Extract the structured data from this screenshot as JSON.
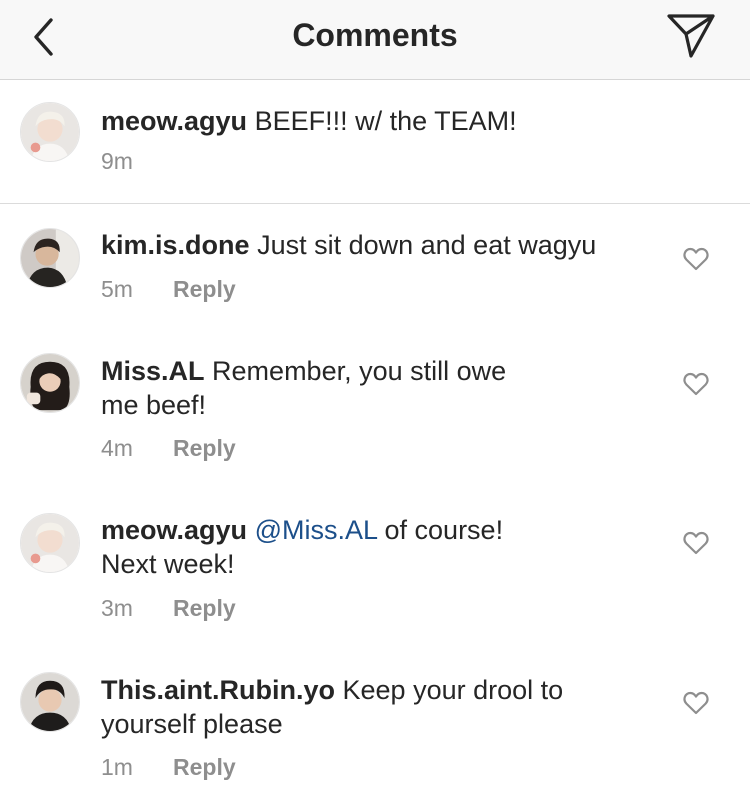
{
  "header": {
    "title": "Comments",
    "back_icon": "chevron-left-icon",
    "send_icon": "paper-plane-icon"
  },
  "caption": {
    "username": "meow.agyu",
    "text": "BEEF!!! w/ the TEAM!",
    "time": "9m"
  },
  "comments": [
    {
      "username": "kim.is.done",
      "text": "Just sit down and eat wagyu",
      "time": "5m",
      "reply_label": "Reply"
    },
    {
      "username": "Miss.AL",
      "text": "Remember, you still owe me beef!",
      "time": "4m",
      "reply_label": "Reply"
    },
    {
      "username": "meow.agyu",
      "mention": "@Miss.AL",
      "text": "of course! Next week!",
      "time": "3m",
      "reply_label": "Reply"
    },
    {
      "username": "This.aint.Rubin.yo",
      "text": "Keep your drool to yourself please",
      "time": "1m",
      "reply_label": "Reply"
    }
  ],
  "colors": {
    "text": "#262626",
    "meta": "#8e8e8e",
    "mention": "#1c4f8a",
    "header_bg": "#f8f8f8"
  }
}
